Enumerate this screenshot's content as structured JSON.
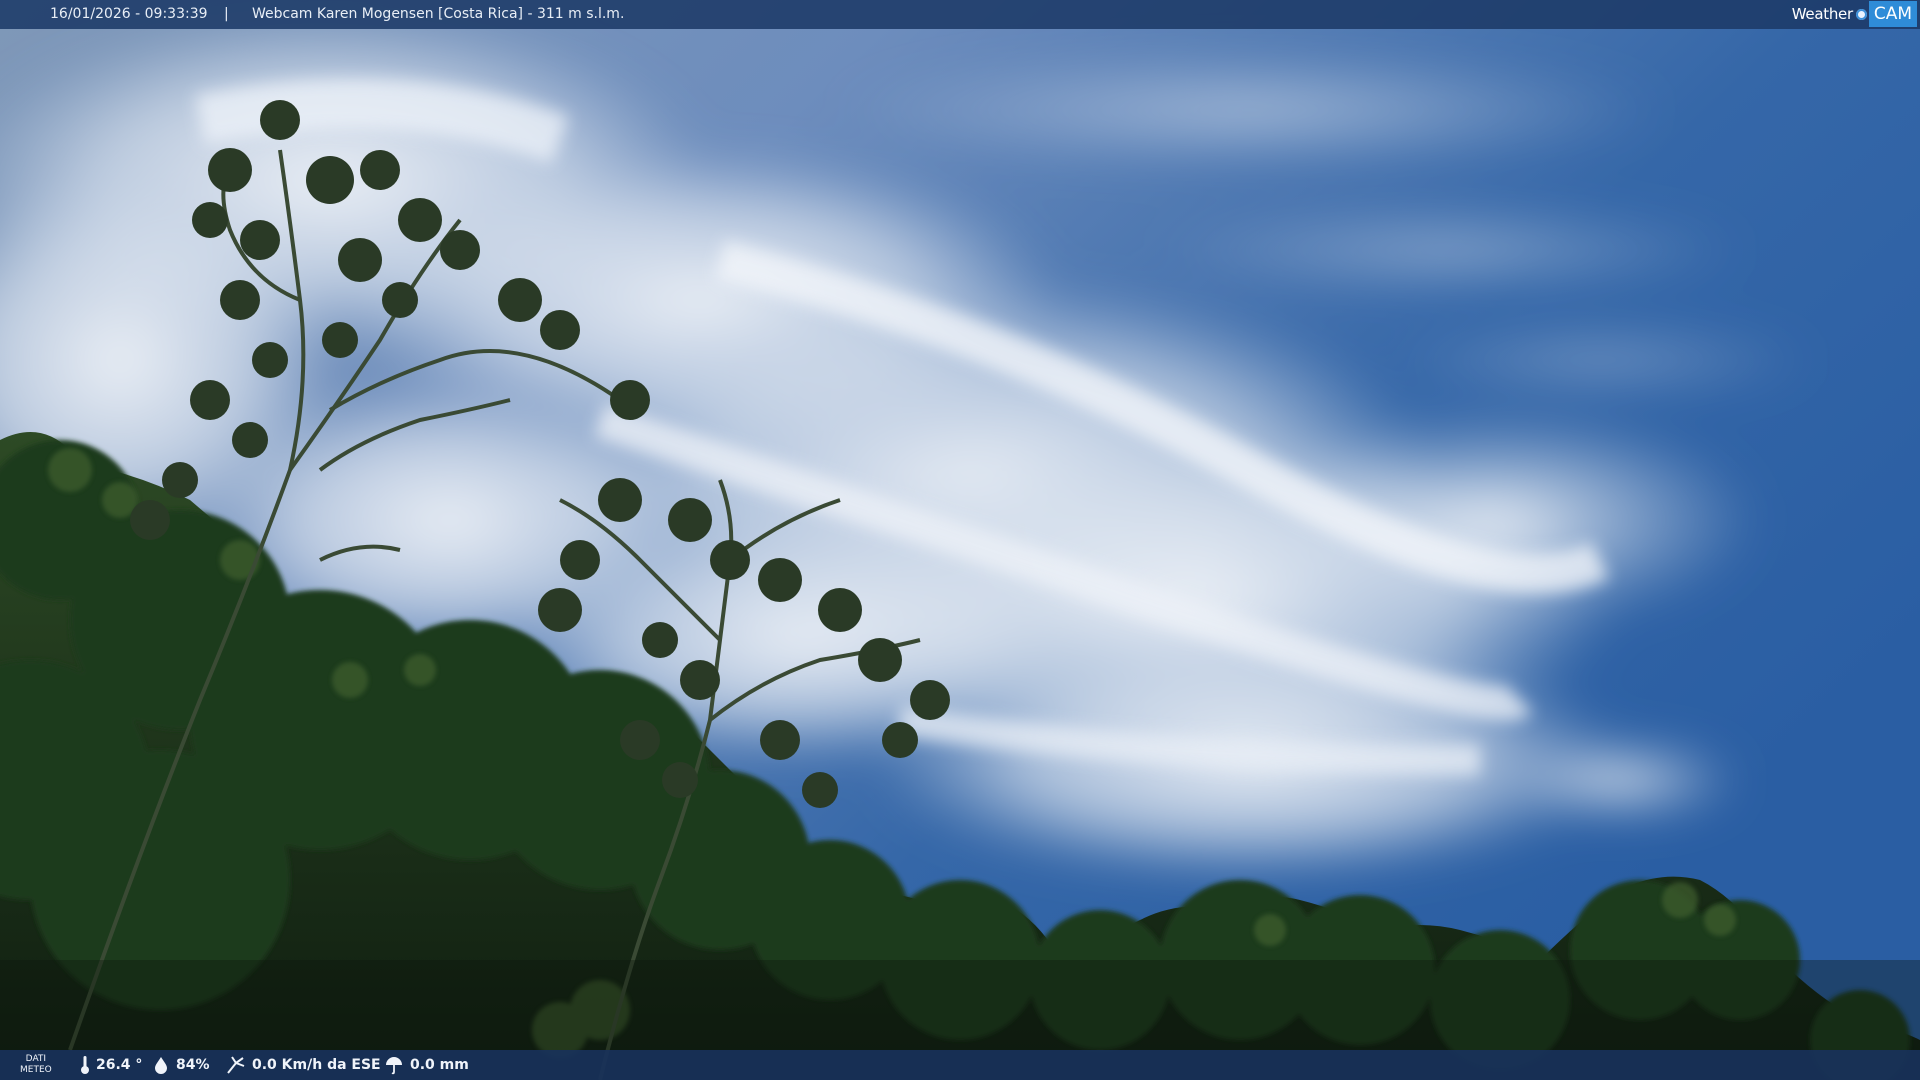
{
  "header": {
    "datetime": "16/01/2026 - 09:33:39",
    "separator": "|",
    "title": "Webcam Karen Mogensen [Costa Rica] - 311 m s.l.m."
  },
  "logo": {
    "weather": "Weather",
    "cam": "CAM"
  },
  "weather_bar": {
    "label_line1": "DATI",
    "label_line2": "METEO",
    "temperature": "26.4 °",
    "temperature_icon": "thermometer-icon",
    "humidity": "84%",
    "humidity_icon": "droplet-icon",
    "wind": "0.0 Km/h da ESE",
    "wind_icon": "wind-icon",
    "rain": "0.0 mm",
    "rain_icon": "umbrella-icon"
  },
  "colors": {
    "bar_background": "#1c3a68",
    "logo_accent": "#2f8cd8",
    "sky_blue": "#2a5a9a"
  }
}
